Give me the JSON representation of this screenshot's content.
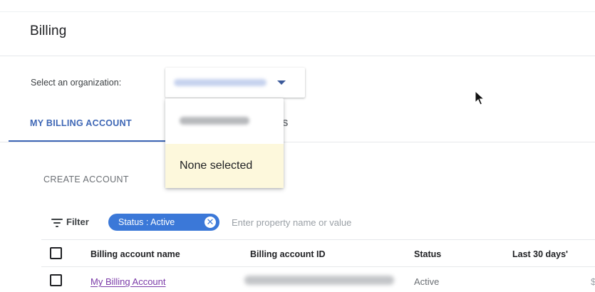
{
  "page": {
    "title": "Billing"
  },
  "organization": {
    "label": "Select an organization:",
    "selected_value": "",
    "menu": {
      "items": [
        {
          "label": ""
        },
        {
          "label": "None selected"
        }
      ]
    }
  },
  "tabs": [
    {
      "label": "MY BILLING ACCOUNT",
      "active": true
    },
    {
      "label": "S",
      "active": false
    }
  ],
  "toolbar": {
    "create_account_label": "CREATE ACCOUNT"
  },
  "filter": {
    "label": "Filter",
    "chip_label": "Status : Active",
    "chip_remove_icon": "✕",
    "input_placeholder": "Enter property name or value"
  },
  "table": {
    "columns": [
      "Billing account name",
      "Billing account ID",
      "Status",
      "Last 30 days'"
    ],
    "rows": [
      {
        "name": "My Billing Account",
        "id": "",
        "status": "Active",
        "last_30_days": "$"
      }
    ]
  },
  "colors": {
    "accent": "#3d66b5",
    "chip": "#3b78d8",
    "link": "#7b3aa8",
    "menu_highlight": "#fdf8dc"
  },
  "icons": {
    "filter": "filter-icon",
    "dropdown": "chevron-down-icon",
    "chip_remove": "close-circle-icon",
    "cursor": "mouse-pointer-icon"
  }
}
